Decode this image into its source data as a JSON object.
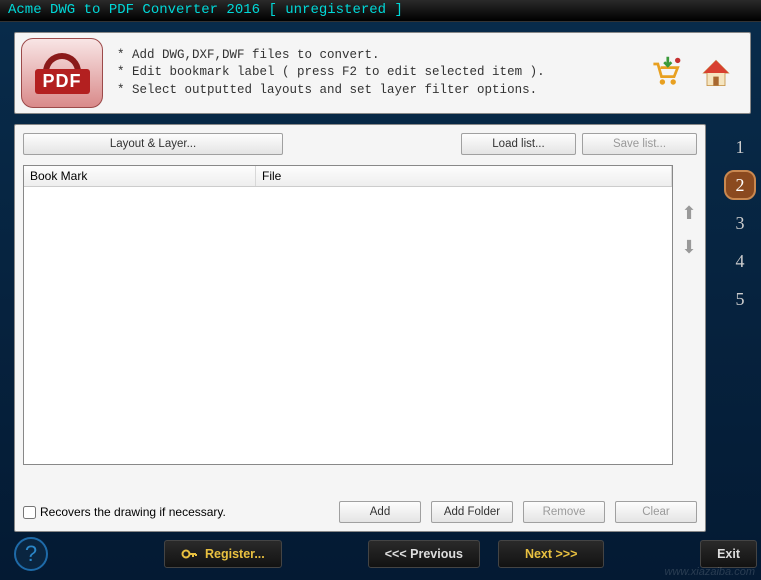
{
  "title": "Acme DWG to PDF Converter 2016 [ unregistered ]",
  "logo": {
    "text": "PDF"
  },
  "tips": {
    "t1": "* Add DWG,DXF,DWF files to convert.",
    "t2": "* Edit bookmark label ( press F2 to edit selected item ).",
    "t3": "* Select outputted layouts and set layer filter options."
  },
  "toolbar": {
    "layout": "Layout & Layer...",
    "load": "Load list...",
    "save": "Save list..."
  },
  "list": {
    "col_bookmark": "Book Mark",
    "col_file": "File",
    "rows": []
  },
  "arrows": {
    "up": "⬆",
    "down": "⬇"
  },
  "recover": {
    "label": "Recovers the drawing if necessary.",
    "checked": false
  },
  "actions": {
    "add": "Add",
    "add_folder": "Add Folder",
    "remove": "Remove",
    "clear": "Clear"
  },
  "steps": {
    "s1": "1",
    "s2": "2",
    "s3": "3",
    "s4": "4",
    "s5": "5",
    "active": 2
  },
  "footer": {
    "help": "?",
    "register": "Register...",
    "previous": "<<<  Previous",
    "next": "Next  >>>",
    "exit": "Exit"
  },
  "watermark": "www.xiazaiba.com"
}
